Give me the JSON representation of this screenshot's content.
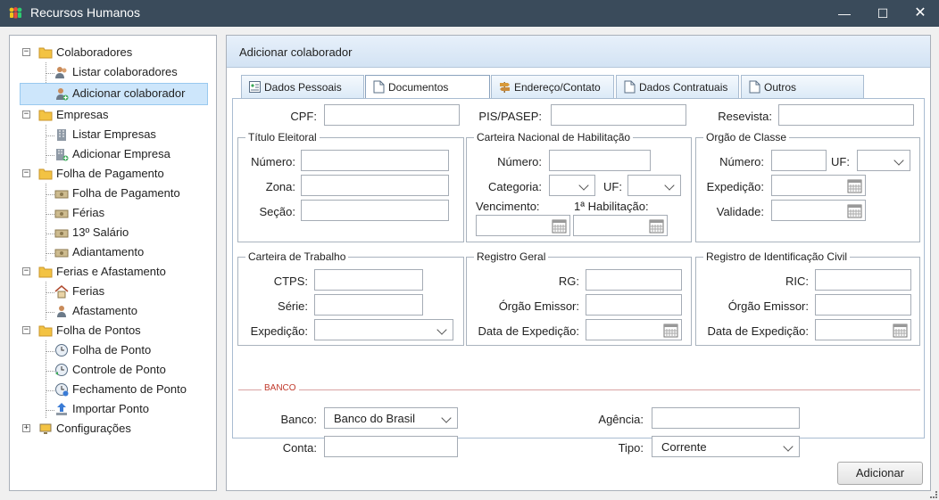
{
  "window": {
    "title": "Recursos Humanos",
    "minimize": "—",
    "maximize": "☐",
    "close": "✕"
  },
  "tree": {
    "colaboradores": {
      "label": "Colaboradores",
      "expander": "−"
    },
    "listar_colaboradores": "Listar colaboradores",
    "adicionar_colaborador": "Adicionar colaborador",
    "empresas": {
      "label": "Empresas",
      "expander": "−"
    },
    "listar_empresas": "Listar Empresas",
    "adicionar_empresa": "Adicionar Empresa",
    "folha_pagamento": {
      "label": "Folha de Pagamento",
      "expander": "−"
    },
    "folha_de_pagamento": "Folha de Pagamento",
    "ferias": "Férias",
    "decimo_terceiro": "13º Salário",
    "adiantamento": "Adiantamento",
    "ferias_afastamento": {
      "label": "Ferias e Afastamento",
      "expander": "−"
    },
    "ferias2": "Ferias",
    "afastamento": "Afastamento",
    "folha_pontos": {
      "label": "Folha de Pontos",
      "expander": "−"
    },
    "folha_de_ponto": "Folha de Ponto",
    "controle_ponto": "Controle de Ponto",
    "fechamento_ponto": "Fechamento de Ponto",
    "importar_ponto": "Importar Ponto",
    "configuracoes": {
      "label": "Configurações",
      "expander": "+"
    }
  },
  "main": {
    "title": "Adicionar colaborador",
    "tabs": [
      "Dados Pessoais",
      "Documentos",
      "Endereço/Contato",
      "Dados Contratuais",
      "Outros"
    ],
    "active_tab": "Documentos"
  },
  "form": {
    "cpf": "CPF:",
    "pis": "PIS/PASEP:",
    "reservista": "Resevista:",
    "titulo": {
      "title": "Título Eleitoral",
      "numero": "Número:",
      "zona": "Zona:",
      "secao": "Seção:"
    },
    "cnh": {
      "title": "Carteira Nacional de Habilitação",
      "numero": "Número:",
      "categoria": "Categoria:",
      "uf": "UF:",
      "vencimento": "Vencimento:",
      "primeira": "1ª Habilitação:"
    },
    "orgao": {
      "title": "Orgão de Classe",
      "numero": "Número:",
      "uf": "UF:",
      "expedicao": "Expedição:",
      "validade": "Validade:"
    },
    "ctps": {
      "title": "Carteira de Trabalho",
      "ctps": "CTPS:",
      "serie": "Série:",
      "expedicao": "Expedição:"
    },
    "rg": {
      "title": "Registro Geral",
      "rg": "RG:",
      "orgao": "Órgão Emissor:",
      "data": "Data de Expedição:"
    },
    "ric": {
      "title": "Registro de Identificação Civil",
      "ric": "RIC:",
      "orgao": "Órgão Emissor:",
      "data": "Data de Expedição:"
    },
    "banco": {
      "section": "BANCO",
      "banco_label": "Banco:",
      "banco_value": "Banco do Brasil",
      "agencia": "Agência:",
      "conta": "Conta:",
      "tipo_label": "Tipo:",
      "tipo_value": "Corrente"
    }
  },
  "actions": {
    "adicionar": "Adicionar"
  },
  "colors": {
    "titlebar": "#3a4b5b",
    "selection": "#cde6fb",
    "header": "#dce8f5",
    "banco_accent": "#c0392b"
  }
}
